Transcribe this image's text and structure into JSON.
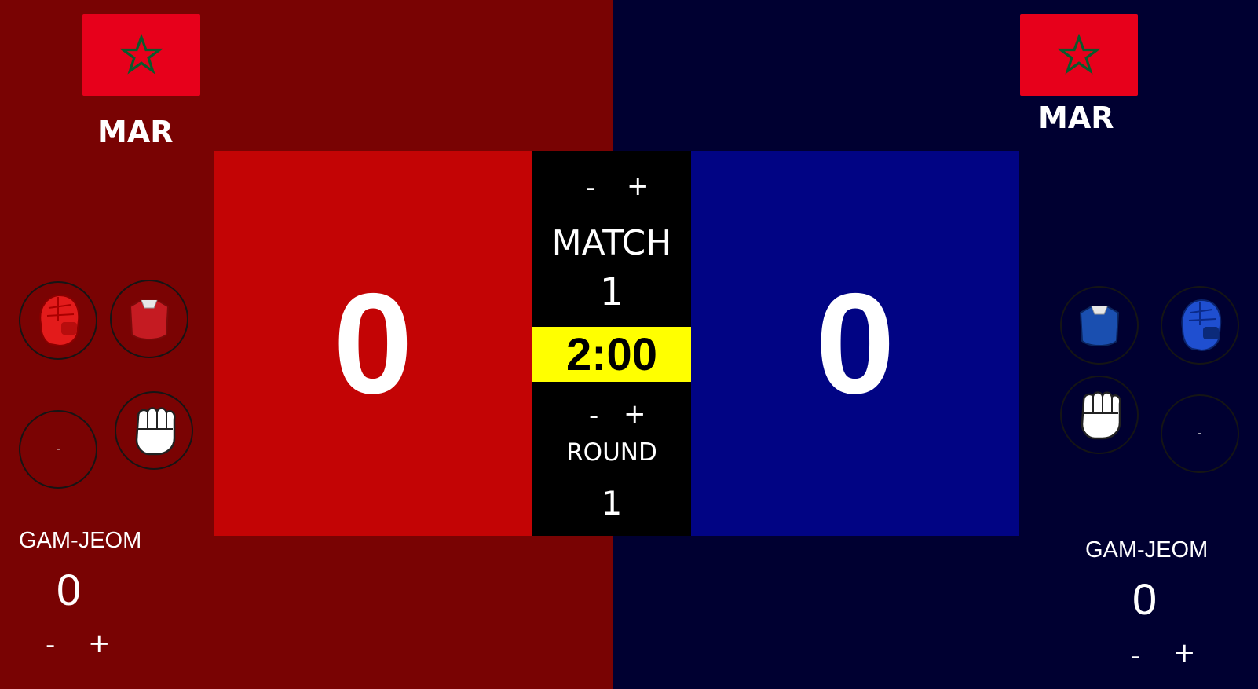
{
  "colors": {
    "red_bg": "#790303",
    "red_panel": "#c30405",
    "blue_bg": "#000031",
    "blue_panel": "#010484",
    "timer_bg": "#ffff00",
    "flag_red": "#e7001b",
    "flag_star": "#006233"
  },
  "red": {
    "country": "MAR",
    "score": "0",
    "gamjeom_label": "GAM-JEOM",
    "gamjeom_value": "0",
    "minus": "-",
    "plus": "+",
    "empty_sensor": "-",
    "icons": [
      "head-protector-red-icon",
      "body-protector-red-icon",
      "punch-fist-icon"
    ]
  },
  "blue": {
    "country": "MAR",
    "score": "0",
    "gamjeom_label": "GAM-JEOM",
    "gamjeom_value": "0",
    "minus": "-",
    "plus": "+",
    "empty_sensor": "-",
    "icons": [
      "body-protector-blue-icon",
      "head-protector-blue-icon",
      "punch-fist-icon"
    ]
  },
  "center": {
    "match_minus": "-",
    "match_plus": "+",
    "match_label": "MATCH",
    "match_number": "1",
    "timer": "2:00",
    "round_minus": "-",
    "round_plus": "+",
    "round_label": "ROUND",
    "round_number": "1"
  }
}
